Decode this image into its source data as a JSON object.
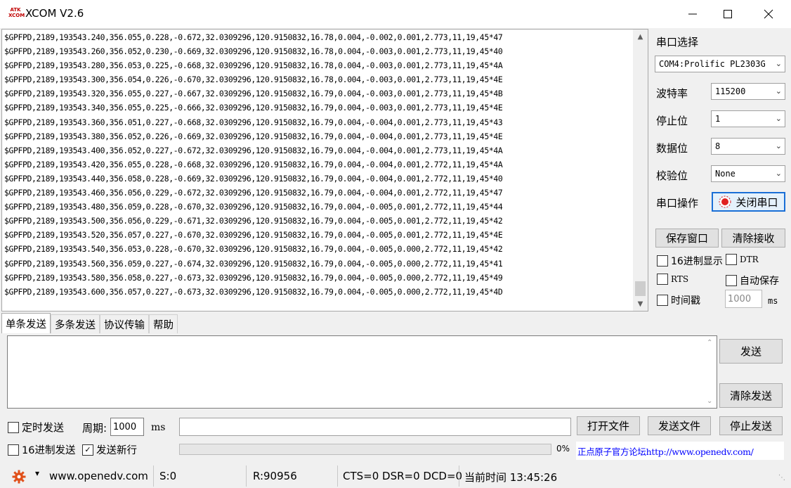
{
  "window": {
    "title": "XCOM V2.6",
    "icon_text": "ATK XCOM"
  },
  "receive": {
    "lines": [
      "$GPFPD,2189,193543.240,356.055,0.228,-0.672,32.0309296,120.9150832,16.78,0.004,-0.002,0.001,2.773,11,19,45*47",
      "$GPFPD,2189,193543.260,356.052,0.230,-0.669,32.0309296,120.9150832,16.78,0.004,-0.003,0.001,2.773,11,19,45*40",
      "$GPFPD,2189,193543.280,356.053,0.225,-0.668,32.0309296,120.9150832,16.78,0.004,-0.003,0.001,2.773,11,19,45*4A",
      "$GPFPD,2189,193543.300,356.054,0.226,-0.670,32.0309296,120.9150832,16.78,0.004,-0.003,0.001,2.773,11,19,45*4E",
      "$GPFPD,2189,193543.320,356.055,0.227,-0.667,32.0309296,120.9150832,16.79,0.004,-0.003,0.001,2.773,11,19,45*4B",
      "$GPFPD,2189,193543.340,356.055,0.225,-0.666,32.0309296,120.9150832,16.79,0.004,-0.003,0.001,2.773,11,19,45*4E",
      "$GPFPD,2189,193543.360,356.051,0.227,-0.668,32.0309296,120.9150832,16.79,0.004,-0.004,0.001,2.773,11,19,45*43",
      "$GPFPD,2189,193543.380,356.052,0.226,-0.669,32.0309296,120.9150832,16.79,0.004,-0.004,0.001,2.773,11,19,45*4E",
      "$GPFPD,2189,193543.400,356.052,0.227,-0.672,32.0309296,120.9150832,16.79,0.004,-0.004,0.001,2.773,11,19,45*4A",
      "$GPFPD,2189,193543.420,356.055,0.228,-0.668,32.0309296,120.9150832,16.79,0.004,-0.004,0.001,2.772,11,19,45*4A",
      "$GPFPD,2189,193543.440,356.058,0.228,-0.669,32.0309296,120.9150832,16.79,0.004,-0.004,0.001,2.772,11,19,45*40",
      "$GPFPD,2189,193543.460,356.056,0.229,-0.672,32.0309296,120.9150832,16.79,0.004,-0.004,0.001,2.772,11,19,45*47",
      "$GPFPD,2189,193543.480,356.059,0.228,-0.670,32.0309296,120.9150832,16.79,0.004,-0.005,0.001,2.772,11,19,45*44",
      "$GPFPD,2189,193543.500,356.056,0.229,-0.671,32.0309296,120.9150832,16.79,0.004,-0.005,0.001,2.772,11,19,45*42",
      "$GPFPD,2189,193543.520,356.057,0.227,-0.670,32.0309296,120.9150832,16.79,0.004,-0.005,0.001,2.772,11,19,45*4E",
      "$GPFPD,2189,193543.540,356.053,0.228,-0.670,32.0309296,120.9150832,16.79,0.004,-0.005,0.000,2.772,11,19,45*42",
      "$GPFPD,2189,193543.560,356.059,0.227,-0.674,32.0309296,120.9150832,16.79,0.004,-0.005,0.000,2.772,11,19,45*41",
      "$GPFPD,2189,193543.580,356.058,0.227,-0.673,32.0309296,120.9150832,16.79,0.004,-0.005,0.000,2.772,11,19,45*49",
      "$GPFPD,2189,193543.600,356.057,0.227,-0.673,32.0309296,120.9150832,16.79,0.004,-0.005,0.000,2.772,11,19,45*4D"
    ]
  },
  "settings": {
    "port_label": "串口选择",
    "port_value": "COM4:Prolific PL2303G",
    "baud_label": "波特率",
    "baud_value": "115200",
    "stop_label": "停止位",
    "stop_value": "1",
    "data_label": "数据位",
    "data_value": "8",
    "parity_label": "校验位",
    "parity_value": "None",
    "op_label": "串口操作",
    "op_button": "关闭串口",
    "save_window": "保存窗口",
    "clear_receive": "清除接收",
    "hex_display": "16进制显示",
    "dtr": "DTR",
    "rts": "RTS",
    "auto_save": "自动保存",
    "timestamp": "时间戳",
    "timestamp_value": "1000",
    "timestamp_unit": "ms"
  },
  "tabs": [
    "单条发送",
    "多条发送",
    "协议传输",
    "帮助"
  ],
  "send": {
    "send_button": "发送",
    "clear_send": "清除发送",
    "timed_send": "定时发送",
    "period_label": "周期:",
    "period_value": "1000",
    "period_unit": "ms",
    "open_file": "打开文件",
    "send_file": "发送文件",
    "stop_send": "停止发送",
    "hex_send": "16进制发送",
    "send_newline": "发送新行",
    "progress": "0%",
    "progress_value": 0,
    "forum_link": "正点原子官方论坛http://www.openedv.com/"
  },
  "status": {
    "website": "www.openedv.com",
    "sent": "S:0",
    "received": "R:90956",
    "lines": "CTS=0 DSR=0 DCD=0",
    "time": "当前时间 13:45:26"
  },
  "colors": {
    "accent": "#1a6fd6",
    "link": "#0000ff",
    "close_icon": "#e02020",
    "gear": "#e0501a"
  }
}
